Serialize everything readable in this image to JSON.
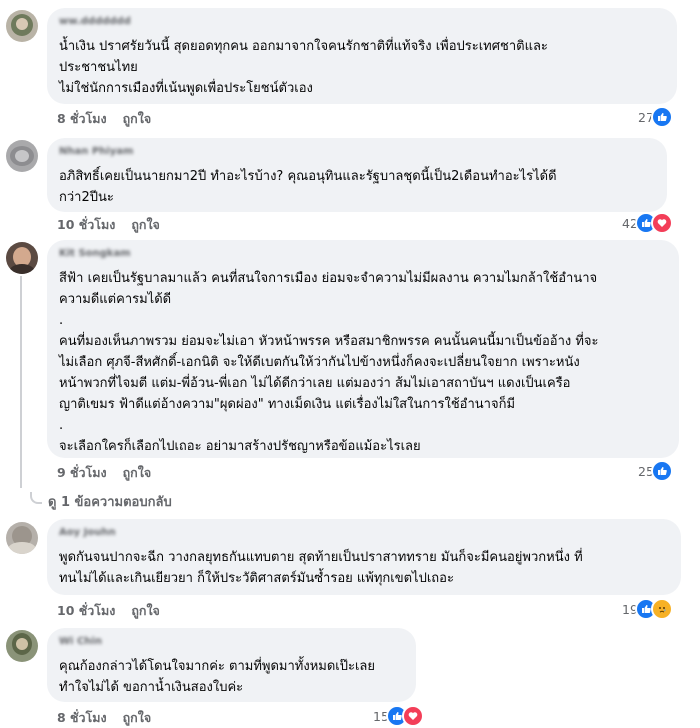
{
  "comments": [
    {
      "author": "ww.ddddddd",
      "lines": [
        "น้ำเงิน ปราศรัยวันนี้ สุดยอดทุกคน ออกมาจากใจคนรักชาติที่แท้จริง เพื่อประเทศชาติและ",
        "ประชาชนไทย",
        "ไม่ใช่นักการเมืองที่เน้นพูดเพื่อประโยชน์ตัวเอง"
      ],
      "time": "8 ชั่วโมง",
      "like_label": "ถูกใจ",
      "reaction_count": "27",
      "reactions": [
        "like"
      ]
    },
    {
      "author": "Nhan Phiyam",
      "lines": [
        "อภิสิทธิ์เคยเป็นนายกมา2ปี ทำอะไรบ้าง? คุณอนุทินและรัฐบาลชุดนี้เป็น2เดือนทำอะไรได้ดี",
        "กว่า2ปีนะ"
      ],
      "time": "10 ชั่วโมง",
      "like_label": "ถูกใจ",
      "reaction_count": "42",
      "reactions": [
        "like",
        "love"
      ]
    },
    {
      "author": "Kit Songkam",
      "lines": [
        "สีฟ้า เคยเป็นรัฐบาลมาแล้ว คนที่สนใจการเมือง ย่อมจะจำความไม่มีผลงาน ความไมกล้าใช้อำนาจ",
        "ความดีแต่คารมได้ดี",
        ".",
        "คนที่มองเห็นภาพรวม ย่อมจะไม่เอา หัวหน้าพรรค หรือสมาชิกพรรค คนนั้นคนนี้มาเป็นข้ออ้าง ที่จะ",
        "ไม่เลือก ศุภจี-สีหศักดิ์-เอกนิติ จะให้ดีเบตกันให้ว่ากันไปข้างหนึ่งก็คงจะเปลี่ยนใจยาก เพราะหนัง",
        "หน้าพวกที่ไจมตี แต่ม-พี่อ้วน-พี่เอก ไม่ได้ดีกว่าเลย แต่มองว่า ส้มไม่เอาสถาบันฯ แดงเป็นเครือ",
        "ญาติเขมร ฟ้าดีแต่อ้างความ\"ผุดผ่อง\" ทางเม็ดเงิน แต่เรื่องไม่ใสในการใช้อำนาจก็มี",
        ".",
        "จะเลือกใครก็เลือกไปเถอะ อย่ามาสร้างปรัชญาหรือข้อแม้อะไรเลย"
      ],
      "time": "9 ชั่วโมง",
      "like_label": "ถูกใจ",
      "reaction_count": "25",
      "reactions": [
        "like"
      ],
      "reply_link": "ดู 1 ข้อความตอบกลับ"
    },
    {
      "author": "Aoy Jouhn",
      "lines": [
        "พูดกันจนปากจะฉีก วางกลยุทธกันแทบตาย สุดท้ายเป็นปราสาททราย มันก็จะมีคนอยู่พวกหนึ่ง ที่",
        "ทนไม่ได้และเกินเยียวยา ก็ให้ประวัติศาสตร์มันซ้ำรอย แพ้ทุกเขตไปเถอะ"
      ],
      "time": "10 ชั่วโมง",
      "like_label": "ถูกใจ",
      "reaction_count": "19",
      "reactions": [
        "like",
        "sad"
      ]
    },
    {
      "author": "Wi Chin",
      "lines": [
        "คุณก้องกล่าวได้โดนใจมากค่ะ ตามที่พูดมาทั้งหมดเป๊ะเลย",
        "ทำใจไม่ได้ ขอกาน้ำเงินสองใบค่ะ"
      ],
      "time": "8 ชั่วโมง",
      "like_label": "ถูกใจ",
      "reaction_count": "15",
      "reactions": [
        "like",
        "love"
      ]
    }
  ],
  "colors": {
    "bubble": "#f0f2f5",
    "meta_text": "#65676b",
    "like_blue": "#1877f2",
    "love_red": "#f33e58",
    "sad_yellow": "#f7b125"
  }
}
